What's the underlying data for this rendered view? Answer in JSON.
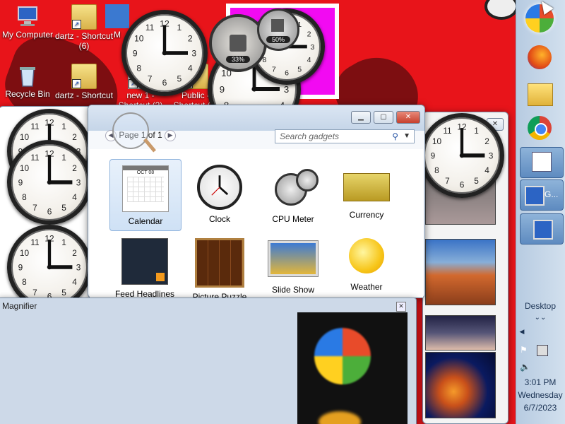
{
  "desktop": {
    "icons": [
      {
        "label": "My Computer"
      },
      {
        "label": "dartz - Shortcut (6)"
      },
      {
        "label": "M"
      },
      {
        "label": "Recycle Bin"
      },
      {
        "label": "dartz - Shortcut"
      },
      {
        "label": "new 1 - Shortcut (2)"
      },
      {
        "label": "Public - Shortcut (2)"
      }
    ]
  },
  "cpu_meter": {
    "cpu": "33%",
    "memory": "50%"
  },
  "gadget_gallery": {
    "pager": "Page 1 of 1",
    "search_placeholder": "Search gadgets",
    "gadgets": [
      {
        "label": "Calendar",
        "month": "OCT 08"
      },
      {
        "label": "Clock"
      },
      {
        "label": "CPU Meter"
      },
      {
        "label": "Currency"
      },
      {
        "label": "Feed Headlines"
      },
      {
        "label": "Picture Puzzle"
      },
      {
        "label": "Slide Show"
      },
      {
        "label": "Weather"
      }
    ]
  },
  "magnifier": {
    "title": "Magnifier"
  },
  "taskbar": {
    "window_button_label": "G...",
    "desktop_label": "Desktop",
    "time": "3:01 PM",
    "day": "Wednesday",
    "date": "6/7/2023"
  }
}
